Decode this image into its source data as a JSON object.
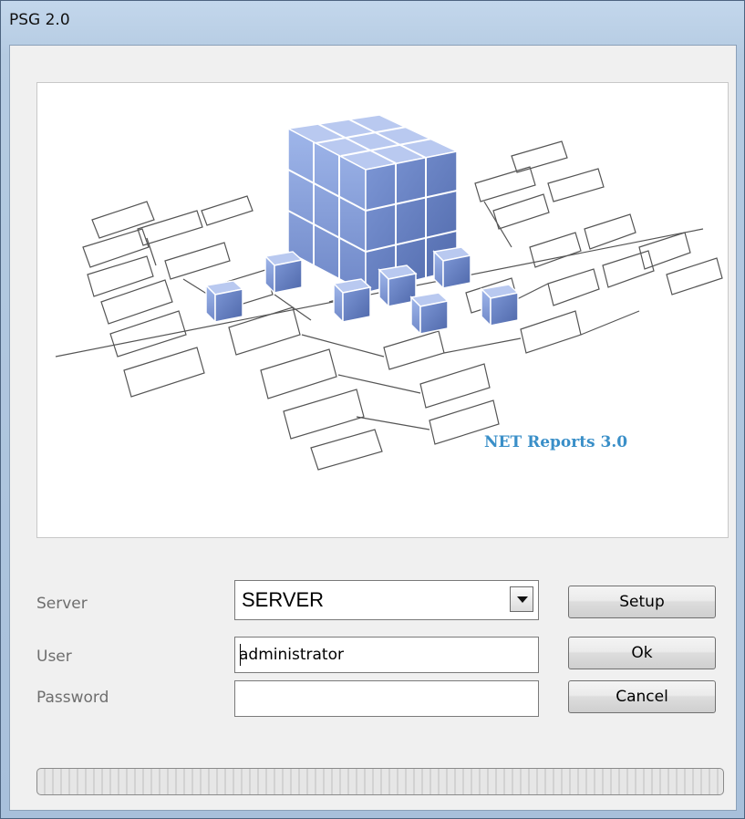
{
  "window": {
    "title": "PSG 2.0"
  },
  "banner": {
    "brand_text": "NET Reports 3.0",
    "brand_color": "#3a8fc8",
    "cube_color": "#7f99d6"
  },
  "form": {
    "server": {
      "label": "Server",
      "value": "SERVER"
    },
    "user": {
      "label": "User",
      "value": "administrator"
    },
    "password": {
      "label": "Password",
      "value": ""
    }
  },
  "buttons": {
    "setup": "Setup",
    "ok": "Ok",
    "cancel": "Cancel"
  },
  "progress": {
    "value": 0
  }
}
